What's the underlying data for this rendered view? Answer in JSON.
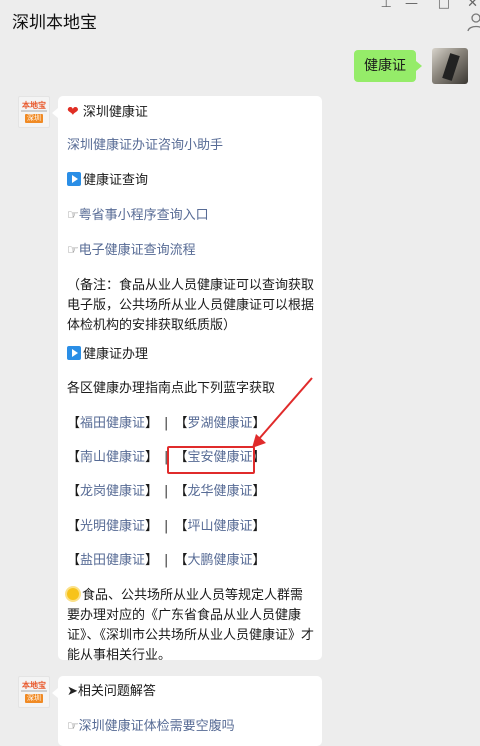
{
  "app": {
    "title": "深圳本地宝"
  },
  "window_controls": {
    "pin": "⊥",
    "minimize": "—",
    "maximize": "□",
    "close": "✕"
  },
  "sent_message": {
    "text": "健康证"
  },
  "message1": {
    "title": "深圳健康证",
    "helper_link": "深圳健康证办证咨询小助手",
    "section_query": "健康证查询",
    "query_link1": "粤省事小程序查询入口",
    "query_link2": "电子健康证查询流程",
    "note": "（备注：食品从业人员健康证可以查询获取电子版，公共场所从业人员健康证可以根据体检机构的安排获取纸质版）",
    "section_apply": "健康证办理",
    "apply_intro": "各区健康办理指南点此下列蓝字获取",
    "district_rows": [
      {
        "a": "福田健康证",
        "b": "罗湖健康证"
      },
      {
        "a": "南山健康证",
        "b": "宝安健康证"
      },
      {
        "a": "龙岗健康证",
        "b": "龙华健康证"
      },
      {
        "a": "光明健康证",
        "b": "坪山健康证"
      },
      {
        "a": "盐田健康证",
        "b": "大鹏健康证"
      }
    ],
    "bracket_open": "【",
    "bracket_close": "】",
    "separator": "|",
    "footer": "食品、公共场所从业人员等规定人群需要办理对应的《广东省食品从业人员健康证》、《深圳市公共场所从业人员健康证》才能从事相关行业。"
  },
  "message2": {
    "title": "相关问题解答",
    "link1": "深圳健康证体检需要空腹吗"
  },
  "avatar": {
    "logo_text": "本地宝",
    "logo_tag": "深圳"
  },
  "colors": {
    "link": "#576b95",
    "sent_bubble": "#95ec69",
    "highlight": "#e02b2b",
    "background": "#ededed"
  },
  "icons": [
    "heart-icon",
    "play-icon",
    "hand-pointer-icon",
    "sun-icon",
    "arrowhead-icon",
    "person-icon"
  ]
}
